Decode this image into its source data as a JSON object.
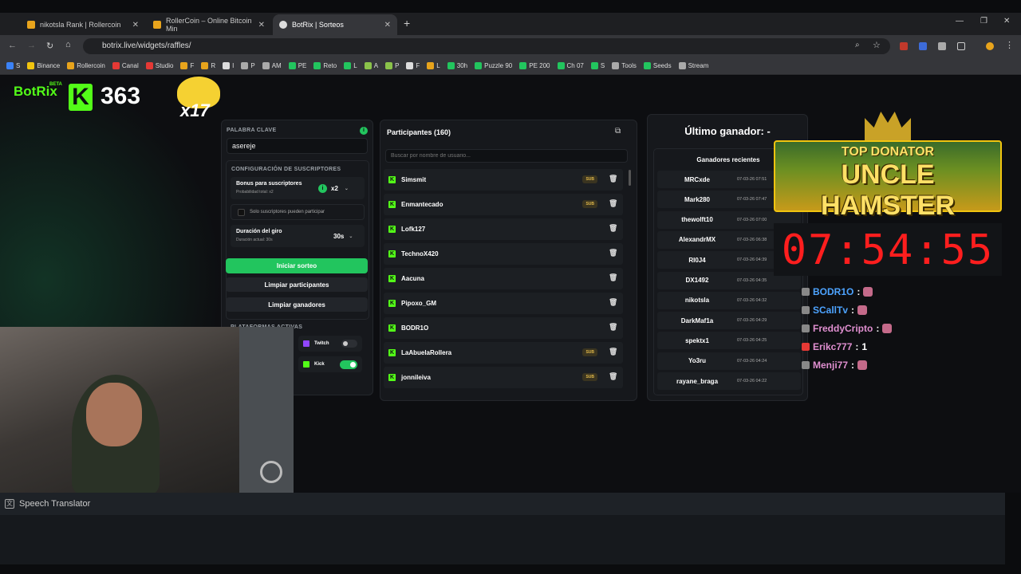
{
  "browser": {
    "tabs": [
      {
        "title": "nikotsla Rank | Rollercoin",
        "active": false
      },
      {
        "title": "RollerCoin – Online Bitcoin Min",
        "active": false
      },
      {
        "title": "BotRix | Sorteos",
        "active": true
      }
    ],
    "url": "botrix.live/widgets/raffles/",
    "bookmarks": [
      "S",
      "Binance",
      "Rollercoin",
      "Canal",
      "Studio",
      "F",
      "R",
      "I",
      "P",
      "AM",
      "PE",
      "Reto",
      "L",
      "A",
      "P",
      "F",
      "L",
      "30h",
      "Puzzle 90",
      "PE 200",
      "Ch 07",
      "S",
      "Tools",
      "Seeds",
      "Stream"
    ]
  },
  "overlay": {
    "brand": "BotRix",
    "brand_badge": "BETA",
    "kick_count": "363",
    "multiplier": "x17",
    "top_donator_label": "TOP DONATOR",
    "top_donator_name": "UNCLE HAMSTER",
    "timer": "07:54:55"
  },
  "settings": {
    "keyword_label": "PALABRA CLAVE",
    "keyword_value": "asereje",
    "subs_config_label": "CONFIGURACIÓN DE SUSCRIPTORES",
    "bonus_title": "Bonus para suscriptores",
    "bonus_sub": "Probabilidad total: x2",
    "bonus_value": "x2",
    "subs_only_label": "Solo suscriptores pueden participar",
    "spin_title": "Duración del giro",
    "spin_sub": "Duración actual: 30s",
    "spin_value": "30s",
    "start_button": "Iniciar sorteo",
    "clear_participants_button": "Limpiar participantes",
    "clear_winners_button": "Limpiar ganadores",
    "platforms_label": "PLATAFORMAS ACTIVAS",
    "platforms": [
      {
        "name": "Twitch",
        "enabled": false
      },
      {
        "name": "Kick",
        "enabled": true
      }
    ]
  },
  "participants": {
    "title": "Participantes (160)",
    "search_placeholder": "Buscar por nombre de usuario...",
    "sub_badge": "SUB",
    "items": [
      {
        "name": "Simsmit",
        "sub": true
      },
      {
        "name": "Enmantecado",
        "sub": true
      },
      {
        "name": "Lofk127",
        "sub": false
      },
      {
        "name": "TechnoX420",
        "sub": false
      },
      {
        "name": "Aacuna",
        "sub": false
      },
      {
        "name": "Pipoxo_GM",
        "sub": false
      },
      {
        "name": "BODR1O",
        "sub": false
      },
      {
        "name": "LaAbuelaRollera",
        "sub": true
      },
      {
        "name": "jonnileiva",
        "sub": true
      }
    ]
  },
  "winners": {
    "last_winner": "Último ganador: -",
    "recent_title": "Ganadores recientes",
    "items": [
      {
        "name": "MRCxde",
        "date": "07-03-26 07:51"
      },
      {
        "name": "Mark280",
        "date": "07-03-26 07:47"
      },
      {
        "name": "thewolft10",
        "date": "07-03-26 07:00"
      },
      {
        "name": "AlexandrMX",
        "date": "07-03-26 06:38"
      },
      {
        "name": "RI0J4",
        "date": "07-03-26 04:39"
      },
      {
        "name": "DX1492",
        "date": "07-03-26 04:35"
      },
      {
        "name": "nikotsla",
        "date": "07-03-26 04:32"
      },
      {
        "name": "DarkMaf1a",
        "date": "07-03-26 04:29"
      },
      {
        "name": "spektx1",
        "date": "07-03-26 04:25"
      },
      {
        "name": "Yo3ru",
        "date": "07-03-26 04:24"
      },
      {
        "name": "rayane_braga",
        "date": "07-03-26 04:22"
      }
    ]
  },
  "chat": [
    {
      "user": "BODR1O",
      "color": "#4da3ff",
      "msg": ""
    },
    {
      "user": "SCallTv",
      "color": "#4da3ff",
      "msg": ""
    },
    {
      "user": "FreddyCripto",
      "color": "#e08fd0",
      "msg": ""
    },
    {
      "user": "Erikc777",
      "color": "#e08fd0",
      "msg": "1"
    },
    {
      "user": "Menji77",
      "color": "#e08fd0",
      "msg": ""
    }
  ],
  "translator": {
    "title": "Speech Translator"
  }
}
